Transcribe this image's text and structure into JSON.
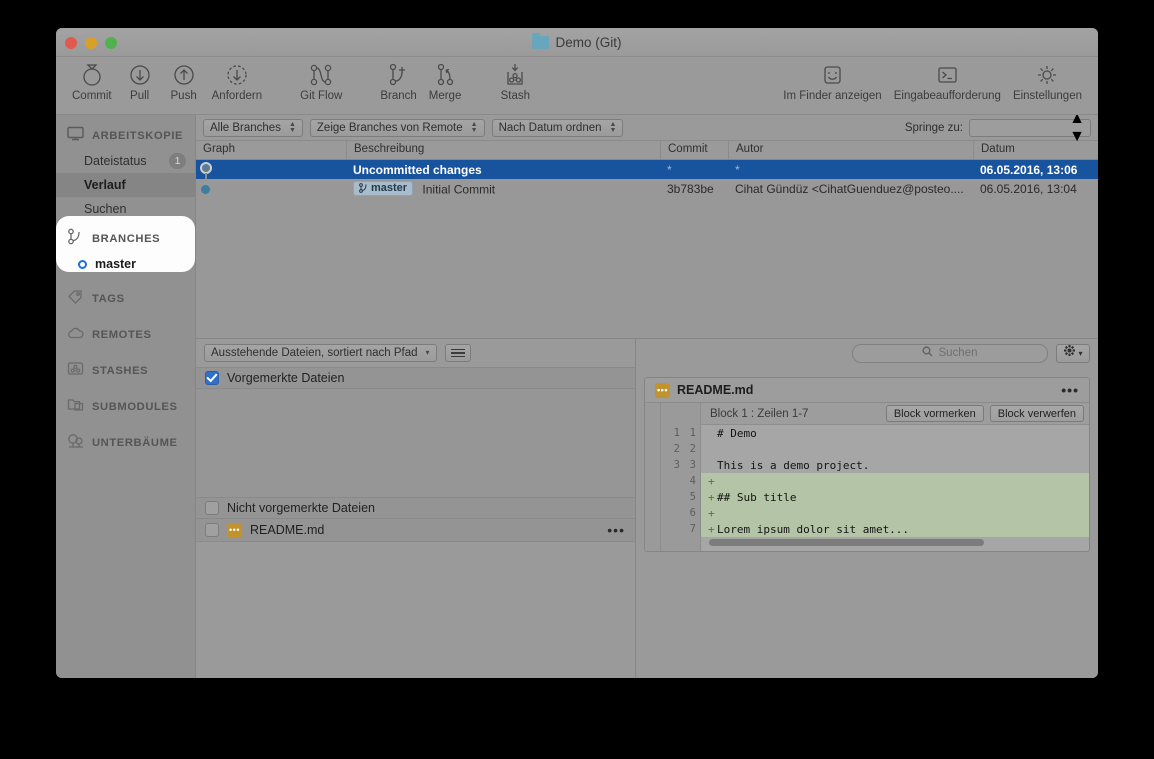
{
  "window": {
    "title": "Demo (Git)",
    "folder_icon": "folder-icon",
    "traffic": {
      "close": "close-button",
      "minimize": "minimize-button",
      "zoom": "zoom-button"
    }
  },
  "toolbar": {
    "items": [
      {
        "label": "Commit",
        "icon": "commit-icon"
      },
      {
        "label": "Pull",
        "icon": "pull-down-arrow-icon"
      },
      {
        "label": "Push",
        "icon": "push-up-arrow-icon"
      },
      {
        "label": "Anfordern",
        "icon": "fetch-dashed-arrow-icon"
      },
      {
        "label": "Git Flow",
        "icon": "git-flow-icon"
      },
      {
        "label": "Branch",
        "icon": "branch-plus-icon"
      },
      {
        "label": "Merge",
        "icon": "merge-icon"
      },
      {
        "label": "Stash",
        "icon": "stash-icon"
      }
    ],
    "right_items": [
      {
        "label": "Im Finder anzeigen",
        "icon": "finder-icon"
      },
      {
        "label": "Eingabeaufforderung",
        "icon": "terminal-icon"
      },
      {
        "label": "Einstellungen",
        "icon": "gear-icon"
      }
    ]
  },
  "sidebar": {
    "sections": [
      {
        "label": "ARBEITSKOPIE",
        "icon": "monitor-icon"
      },
      {
        "label": "BRANCHES",
        "icon": "branch-icon"
      },
      {
        "label": "TAGS",
        "icon": "tag-icon"
      },
      {
        "label": "REMOTES",
        "icon": "cloud-icon"
      },
      {
        "label": "STASHES",
        "icon": "stash-box-icon"
      },
      {
        "label": "SUBMODULES",
        "icon": "submodule-folder-icon"
      },
      {
        "label": "UNTERBÄUME",
        "icon": "subtree-tree-icon"
      }
    ],
    "workingcopy_items": [
      {
        "label": "Dateistatus",
        "badge": "1",
        "selected": false
      },
      {
        "label": "Verlauf",
        "badge": "",
        "selected": true
      },
      {
        "label": "Suchen",
        "badge": "",
        "selected": false
      }
    ],
    "branches": [
      {
        "label": "master",
        "selected": true
      }
    ]
  },
  "filterbar": {
    "branch_filter": "Alle Branches",
    "remote_filter": "Zeige Branches von Remote",
    "sort_filter": "Nach Datum ordnen",
    "jump_label": "Springe zu:",
    "jump_value": ""
  },
  "commits": {
    "columns": [
      "Graph",
      "Beschreibung",
      "Commit",
      "Autor",
      "Datum"
    ],
    "rows": [
      {
        "description": "Uncommitted changes",
        "tag": "",
        "hash": "*",
        "author": "*",
        "date": "06.05.2016, 13:06",
        "selected": true
      },
      {
        "description": "Initial Commit",
        "tag": "master",
        "hash": "3b783be",
        "author": "Cihat Gündüz <CihatGuenduez@posteo....",
        "date": "06.05.2016, 13:04",
        "selected": false
      }
    ]
  },
  "files": {
    "sort_popup": "Ausstehende Dateien, sortiert nach Pfad",
    "list_view_button": "list-view-button",
    "search_placeholder": "Suchen",
    "search_value": "",
    "gear_button": "gear-options-button",
    "staged_header": "Vorgemerkte Dateien",
    "unstaged_header": "Nicht vorgemerkte Dateien",
    "unstaged_files": [
      {
        "name": "README.md",
        "icon": "markdown-file-icon",
        "checked": false
      }
    ]
  },
  "diff": {
    "filename": "README.md",
    "file_icon": "markdown-file-icon",
    "more_button": "more-options-button",
    "block_title": "Block 1 : Zeilen 1-7",
    "stage_block_button": "Block vormerken",
    "discard_block_button": "Block verwerfen",
    "lines": [
      {
        "old": "1",
        "new": "1",
        "type": "ctx",
        "text": "# Demo"
      },
      {
        "old": "2",
        "new": "2",
        "type": "ctx",
        "text": ""
      },
      {
        "old": "3",
        "new": "3",
        "type": "ctx",
        "text": "This is a demo project."
      },
      {
        "old": "",
        "new": "4",
        "type": "add",
        "text": ""
      },
      {
        "old": "",
        "new": "5",
        "type": "add",
        "text": "## Sub title"
      },
      {
        "old": "",
        "new": "6",
        "type": "add",
        "text": ""
      },
      {
        "old": "",
        "new": "7",
        "type": "add",
        "text": "Lorem ipsum dolor sit amet..."
      }
    ]
  },
  "colors": {
    "selection_blue": "#18539e",
    "added_green": "#b4c4a6",
    "checkbox_blue": "#3170c9",
    "branch_dot_blue": "#1e6fd9",
    "md_icon_gold": "#c2932c",
    "folder_teal": "#68a6bd"
  }
}
